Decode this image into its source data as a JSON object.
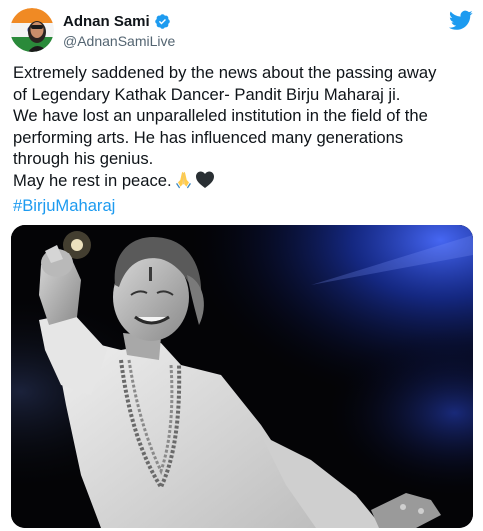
{
  "author": {
    "display_name": "Adnan Sami",
    "handle": "@AdnanSamiLive",
    "verified": true,
    "avatar_icon": "avatar-photo"
  },
  "platform_icon": "twitter-bird-icon",
  "colors": {
    "brand_blue": "#1d9bf0",
    "text_primary": "#0f1419",
    "text_secondary": "#536471",
    "media_spotlight": "#1f3fd1"
  },
  "tweet": {
    "lines": [
      "Extremely saddened by the news about the passing away",
      "of Legendary Kathak Dancer- Pandit Birju Maharaj ji.",
      "We have lost an unparalleled institution in the field of the",
      "performing arts. He has influenced many generations",
      "through his genius.",
      "May he rest in peace."
    ],
    "emojis": [
      "folded-hands-icon",
      "black-heart-icon"
    ],
    "hashtag": "#BirjuMaharaj"
  },
  "media": {
    "kind": "photo",
    "description_icon": "dancer-photo"
  }
}
